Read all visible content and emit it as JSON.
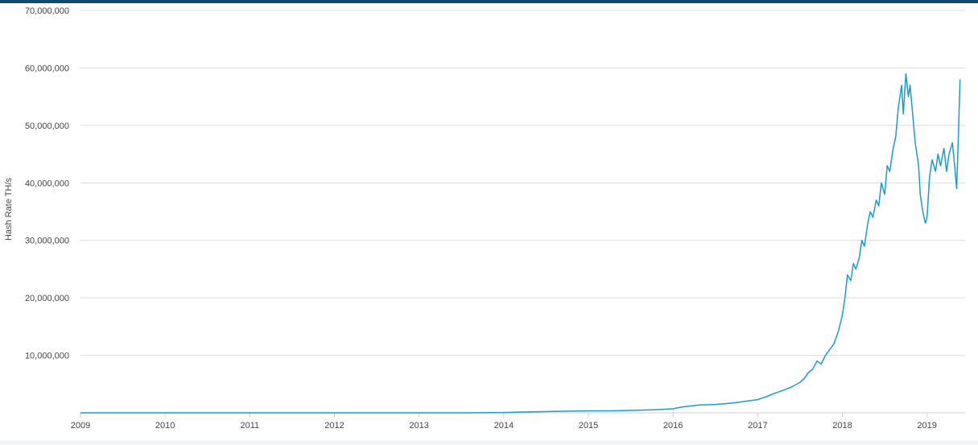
{
  "chart_data": {
    "type": "line",
    "title": "",
    "xlabel": "",
    "ylabel": "Hash Rate TH/s",
    "xlim": [
      2009.0,
      2019.45
    ],
    "ylim": [
      0,
      70000000
    ],
    "x_ticks": [
      "2009",
      "2010",
      "2011",
      "2012",
      "2013",
      "2014",
      "2015",
      "2016",
      "2017",
      "2018",
      "2019"
    ],
    "y_ticks": [
      "10,000,000",
      "20,000,000",
      "30,000,000",
      "40,000,000",
      "50,000,000",
      "60,000,000",
      "70,000,000"
    ],
    "grid": "horizontal",
    "line_color": "#1a9bcd",
    "series": [
      {
        "x": [
          2009.0,
          2010.0,
          2011.0,
          2012.0,
          2013.0,
          2013.5,
          2014.0,
          2014.3,
          2014.6,
          2014.9,
          2015.0,
          2015.3,
          2015.6,
          2015.8,
          2016.0,
          2016.1,
          2016.3,
          2016.5,
          2016.7,
          2016.85,
          2017.0,
          2017.1,
          2017.2,
          2017.3,
          2017.4,
          2017.5,
          2017.55,
          2017.6,
          2017.65,
          2017.7,
          2017.75,
          2017.8,
          2017.85,
          2017.9,
          2017.95,
          2018.0,
          2018.03,
          2018.06,
          2018.1,
          2018.13,
          2018.16,
          2018.2,
          2018.23,
          2018.26,
          2018.3,
          2018.33,
          2018.36,
          2018.4,
          2018.43,
          2018.46,
          2018.5,
          2018.53,
          2018.56,
          2018.6,
          2018.63,
          2018.66,
          2018.7,
          2018.72,
          2018.75,
          2018.78,
          2018.8,
          2018.83,
          2018.86,
          2018.9,
          2018.92,
          2018.95,
          2018.98,
          2019.0,
          2019.03,
          2019.06,
          2019.1,
          2019.13,
          2019.16,
          2019.2,
          2019.23,
          2019.26,
          2019.3,
          2019.32,
          2019.35,
          2019.37,
          2019.39
        ],
        "y": [
          0,
          0,
          0,
          0,
          0,
          5000,
          50000,
          150000,
          250000,
          320000,
          330000,
          350000,
          450000,
          550000,
          700000,
          1000000,
          1350000,
          1450000,
          1700000,
          2000000,
          2300000,
          2800000,
          3400000,
          3900000,
          4500000,
          5300000,
          6000000,
          7000000,
          7600000,
          9000000,
          8500000,
          10000000,
          11000000,
          12000000,
          14000000,
          17000000,
          20000000,
          24000000,
          23000000,
          26000000,
          25000000,
          27000000,
          30000000,
          29000000,
          33000000,
          35000000,
          34000000,
          37000000,
          36000000,
          40000000,
          38000000,
          43000000,
          42000000,
          46000000,
          48000000,
          53000000,
          57000000,
          52000000,
          59000000,
          55000000,
          57000000,
          52000000,
          47000000,
          43000000,
          38000000,
          35000000,
          33000000,
          34000000,
          41000000,
          44000000,
          42000000,
          45000000,
          43000000,
          46000000,
          42000000,
          45000000,
          47000000,
          44000000,
          39000000,
          48000000,
          58000000
        ]
      }
    ]
  }
}
